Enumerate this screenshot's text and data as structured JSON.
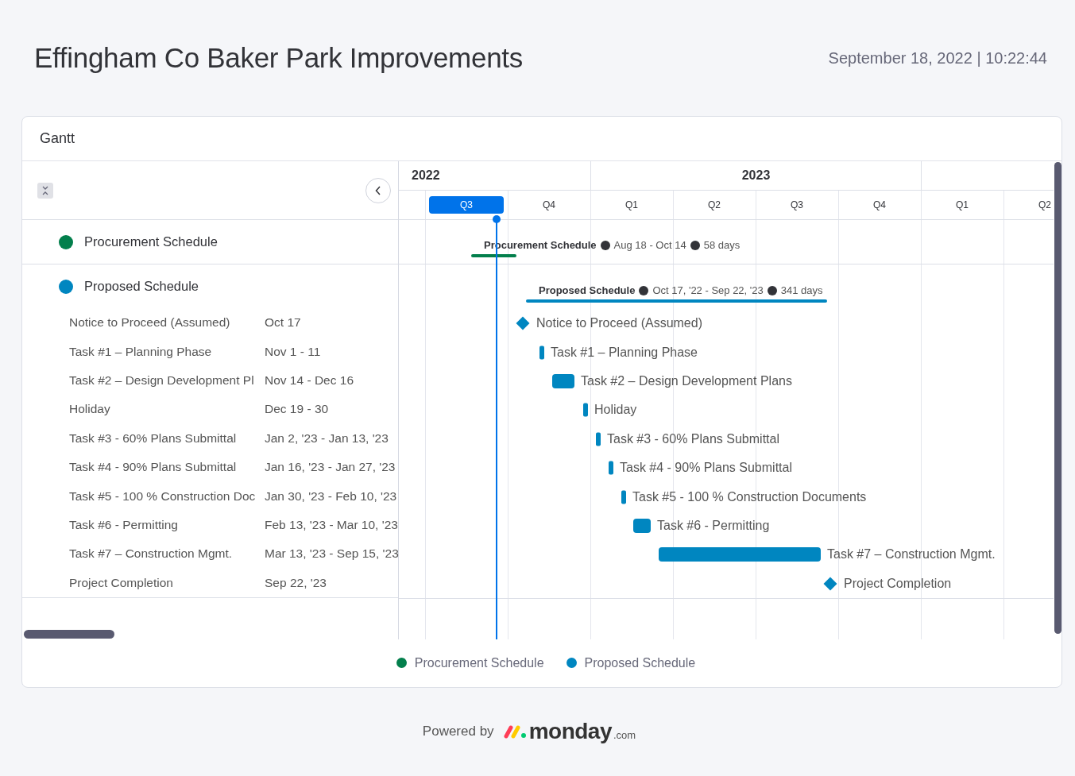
{
  "header": {
    "title": "Effingham Co Baker Park Improvements",
    "timestamp": "September 18, 2022 | 10:22:44"
  },
  "gantt": {
    "title": "Gantt",
    "years": [
      "2022",
      "2023"
    ],
    "quarters": [
      {
        "label": "Q3",
        "selected": true
      },
      {
        "label": "Q4",
        "selected": false
      },
      {
        "label": "Q1",
        "selected": false
      },
      {
        "label": "Q2",
        "selected": false
      },
      {
        "label": "Q3",
        "selected": false
      },
      {
        "label": "Q4",
        "selected": false
      },
      {
        "label": "Q1",
        "selected": false
      },
      {
        "label": "Q2",
        "selected": false
      }
    ],
    "groups": [
      {
        "name": "Procurement Schedule",
        "color": "#037f4c",
        "bar_name": "Procurement Schedule",
        "dates": "Aug 18 - Oct 14",
        "duration": "58 days"
      },
      {
        "name": "Proposed Schedule",
        "color": "#0086c0",
        "bar_name": "Proposed Schedule",
        "dates": "Oct 17, '22 - Sep 22, '23",
        "duration": "341 days",
        "items": [
          {
            "kind": "milestone",
            "name": "Notice to Proceed (Assumed)",
            "dates": "Oct 17",
            "bar_label": "Notice to Proceed (Assumed)"
          },
          {
            "kind": "task",
            "name": "Task #1 – Planning Phase",
            "dates": "Nov 1 - 11",
            "bar_label": "Task #1 – Planning Phase"
          },
          {
            "kind": "task",
            "name": "Task #2 – Design Development Pl",
            "dates": "Nov 14 - Dec 16",
            "bar_label": "Task #2 – Design Development Plans"
          },
          {
            "kind": "task",
            "name": "Holiday",
            "dates": "Dec 19 - 30",
            "bar_label": "Holiday"
          },
          {
            "kind": "task",
            "name": "Task #3 - 60% Plans Submittal",
            "dates": "Jan 2, '23 - Jan 13, '23",
            "bar_label": "Task #3 - 60% Plans Submittal"
          },
          {
            "kind": "task",
            "name": "Task #4 - 90% Plans Submittal",
            "dates": "Jan 16, '23 - Jan 27, '23",
            "bar_label": "Task #4 - 90% Plans Submittal"
          },
          {
            "kind": "task",
            "name": "Task #5 - 100 % Construction Doc",
            "dates": "Jan 30, '23 - Feb 10, '23",
            "bar_label": "Task #5 - 100 % Construction Documents"
          },
          {
            "kind": "task",
            "name": "Task #6 - Permitting",
            "dates": "Feb 13, '23 - Mar 10, '23",
            "bar_label": "Task #6 - Permitting"
          },
          {
            "kind": "task",
            "name": "Task #7 – Construction Mgmt.",
            "dates": "Mar 13, '23 - Sep 15, '23",
            "bar_label": "Task #7 – Construction Mgmt."
          },
          {
            "kind": "milestone",
            "name": "Project Completion",
            "dates": "Sep 22, '23",
            "bar_label": "Project Completion"
          }
        ]
      }
    ],
    "legend": [
      {
        "label": "Procurement Schedule",
        "color": "#037f4c"
      },
      {
        "label": "Proposed Schedule",
        "color": "#0086c0"
      }
    ]
  },
  "footer": {
    "prefix": "Powered by",
    "brand": "monday",
    "suffix": ".com"
  }
}
